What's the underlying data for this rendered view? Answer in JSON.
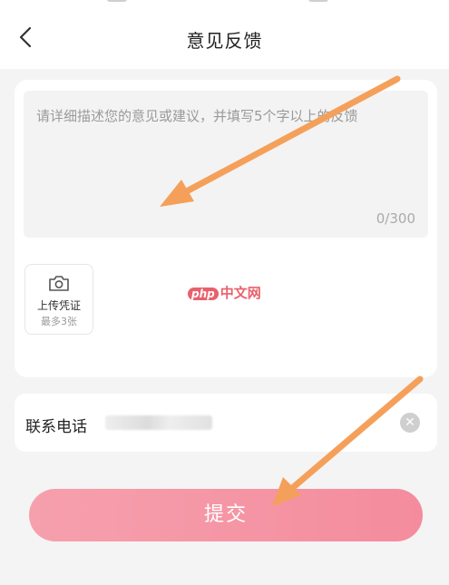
{
  "header": {
    "title": "意见反馈",
    "back_icon": "chevron-left-icon"
  },
  "feedback": {
    "placeholder": "请详细描述您的意见或建议，并填写5个字以上的反馈",
    "counter": "0/300"
  },
  "upload": {
    "label": "上传凭证",
    "limit": "最多3张",
    "icon": "camera-icon"
  },
  "watermark": {
    "badge": "php",
    "text": "中文网"
  },
  "phone": {
    "label": "联系电话",
    "clear_icon": "clear-icon"
  },
  "submit": {
    "label": "提交"
  },
  "colors": {
    "accent": "#f48c9d",
    "arrow": "#f5a05a"
  }
}
